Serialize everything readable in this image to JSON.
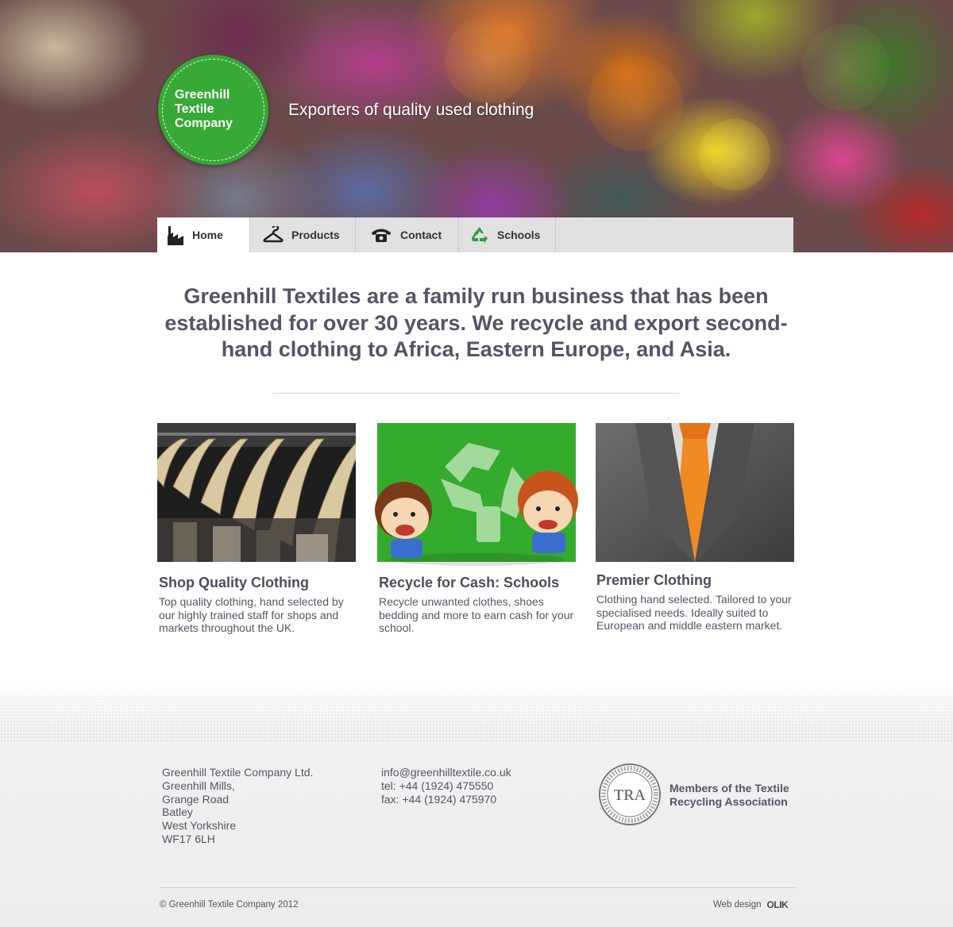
{
  "brand": {
    "logo_lines": [
      "Greenhill",
      "Textile",
      "Company"
    ],
    "tagline": "Exporters of quality used clothing",
    "accent_color": "#36a936"
  },
  "nav": {
    "items": [
      {
        "label": "Home",
        "icon": "factory-icon",
        "active": true
      },
      {
        "label": "Products",
        "icon": "hanger-icon",
        "active": false
      },
      {
        "label": "Contact",
        "icon": "telephone-icon",
        "active": false
      },
      {
        "label": "Schools",
        "icon": "recycle-icon",
        "active": false
      }
    ]
  },
  "intro": {
    "text": "Greenhill Textiles are a family run business that has been established for over 30 years. We recycle and export second-hand clothing to Africa, Eastern Europe, and Asia."
  },
  "features": [
    {
      "title": "Shop Quality Clothing",
      "text": "Top quality clothing, hand selected by our highly trained staff for shops and markets throughout the UK."
    },
    {
      "title": "Recycle for Cash: Schools",
      "text": "Recycle unwanted clothes, shoes bedding and more to earn cash for your school."
    },
    {
      "title": "Premier Clothing",
      "text": "Clothing hand selected. Tailored to your specialised needs. Ideally suited to European and middle eastern market."
    }
  ],
  "footer": {
    "address": [
      "Greenhill Textile Company Ltd.",
      "Greenhill Mills,",
      "Grange Road",
      "Batley",
      "West Yorkshire",
      "WF17 6LH"
    ],
    "email": "info@greenhilltextile.co.uk",
    "tel": "tel: +44 (1924) 475550",
    "fax": "fax: +44 (1924) 475970",
    "membership": [
      "Members of the Textile",
      "Recycling Association"
    ],
    "seal_text": "TRA",
    "copyright": "© Greenhill Textile Company 2012",
    "credit_label": "Web design",
    "credit_brand": "OLIK"
  }
}
